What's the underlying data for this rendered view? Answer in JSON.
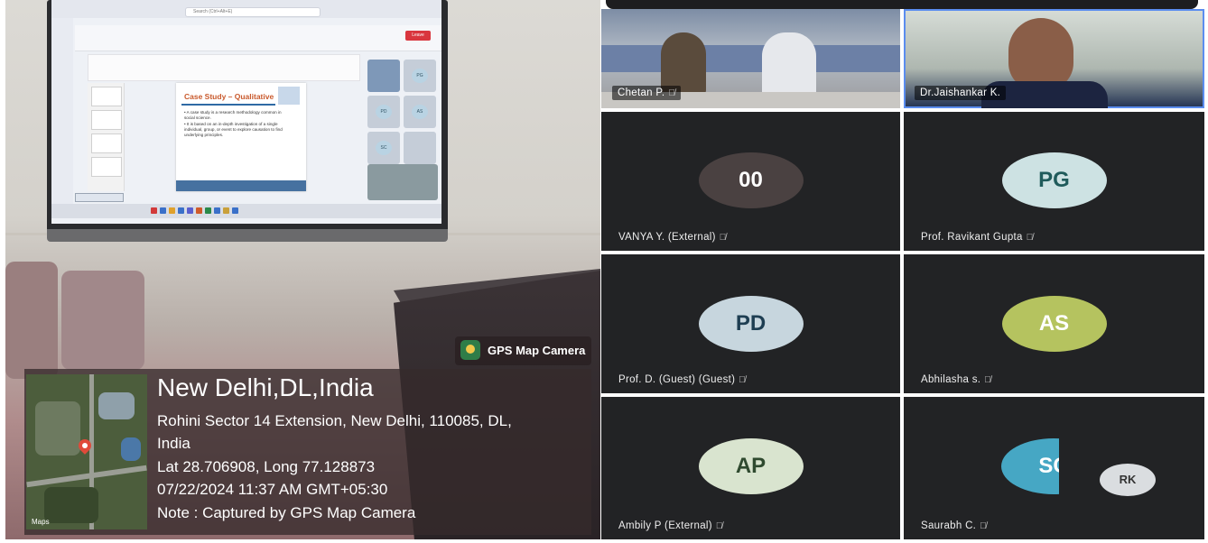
{
  "photo": {
    "screen": {
      "search_placeholder": "Search (Ctrl+Alt+E)",
      "leave_label": "Leave",
      "slide_title": "Case Study – Qualitative",
      "slide_bullets": [
        "• A case study is a research methodology common in social science.",
        "• It is based on an in-depth investigation of a single individual, group, or event to explore causation to find underlying principles."
      ],
      "tile_initials": [
        "PG",
        "PD",
        "AS",
        "SC"
      ]
    },
    "gps_badge": "GPS Map Camera",
    "gps_panel": {
      "city": "New Delhi,DL,India",
      "address_line1": "Rohini Sector 14 Extension, New Delhi, 110085, DL,",
      "address_line2": "India",
      "coords": "Lat 28.706908, Long 77.128873",
      "datetime": "07/22/2024 11:37 AM GMT+05:30",
      "note": "Note : Captured by GPS Map Camera",
      "map_label": "Maps"
    }
  },
  "meet": {
    "video_tiles": [
      {
        "name": "Chetan P.",
        "muted": true
      },
      {
        "name": "Dr.Jaishankar K.",
        "muted": false,
        "active_speaker": true
      }
    ],
    "avatar_tiles": [
      {
        "initials": "00",
        "name": "VANYA Y. (External)",
        "color": "#4a4141",
        "text_color": "#ffffff"
      },
      {
        "initials": "PG",
        "name": "Prof. Ravikant Gupta",
        "color": "#cde2e3",
        "text_color": "#1f5b5b"
      },
      {
        "initials": "PD",
        "name": "Prof. D. (Guest) (Guest)",
        "color": "#c7d6de",
        "text_color": "#1e3e52"
      },
      {
        "initials": "AS",
        "name": "Abhilasha s.",
        "color": "#b5c35f",
        "text_color": "#ffffff"
      },
      {
        "initials": "AP",
        "name": "Ambily P (External)",
        "color": "#d9e4cf",
        "text_color": "#2f4a2f"
      },
      {
        "initials": "SC",
        "name": "Saurabh C.",
        "color": "#46a7c4",
        "text_color": "#ffffff"
      }
    ],
    "extra_avatar": "RK",
    "muted_icon": "mic-off-icon"
  }
}
